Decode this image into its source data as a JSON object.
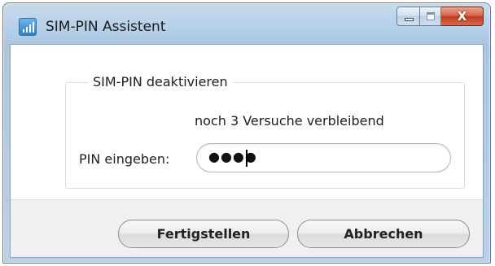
{
  "window": {
    "title": "SIM-PIN Assistent",
    "close_glyph": "X"
  },
  "group": {
    "title": "SIM-PIN deaktivieren",
    "attempts_text": "noch 3 Versuche verbleibend",
    "pin_label": "PIN eingeben:",
    "pin_value_masked": "●●●●"
  },
  "buttons": {
    "finish": "Fertigstellen",
    "cancel": "Abbrechen"
  },
  "icons": {
    "app": "signal-bars-icon",
    "minimize": "minimize-icon",
    "maximize": "maximize-icon",
    "close": "close-icon"
  }
}
